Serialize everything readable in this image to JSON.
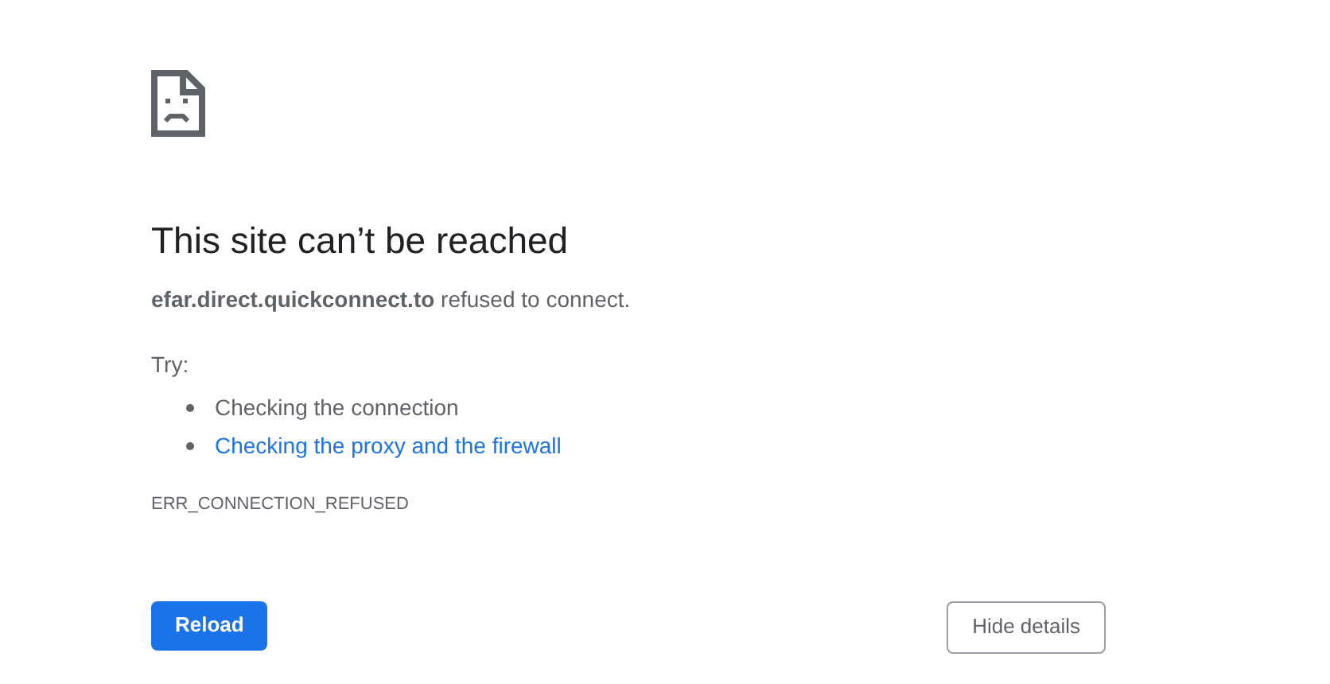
{
  "heading": "This site can’t be reached",
  "message": "**efar.direct.quickconnect.to** refused to connect.",
  "try_label": "Try:",
  "suggestions": [
    {
      "kind": "text",
      "label": "Checking the connection"
    },
    {
      "kind": "link",
      "label": "Checking the proxy and the firewall"
    }
  ],
  "error_code": "ERR_CONNECTION_REFUSED",
  "buttons": [
    {
      "kind": "primary",
      "label": "Reload"
    },
    {
      "kind": "secondary",
      "label": "Hide details"
    }
  ]
}
